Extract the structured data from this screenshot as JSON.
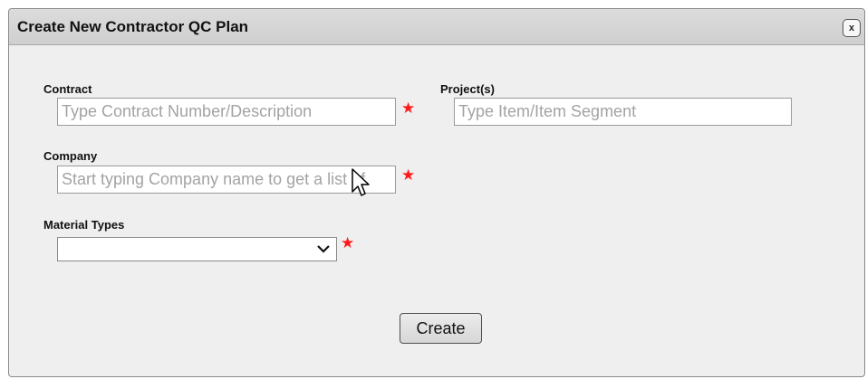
{
  "dialog": {
    "title": "Create New Contractor QC Plan",
    "close_label": "x"
  },
  "form": {
    "contract": {
      "label": "Contract",
      "placeholder": "Type Contract Number/Description",
      "required_marker": "★"
    },
    "projects": {
      "label": "Project(s)",
      "placeholder": "Type Item/Item Segment"
    },
    "company": {
      "label": "Company",
      "placeholder": "Start typing Company name to get a list of",
      "required_marker": "★"
    },
    "material_types": {
      "label": "Material Types",
      "selected": "",
      "required_marker": "★"
    },
    "create_label": "Create"
  },
  "colors": {
    "required_star": "#ff1a1a",
    "title_bar": "#d5d5d5",
    "dialog_body": "#efefef"
  }
}
